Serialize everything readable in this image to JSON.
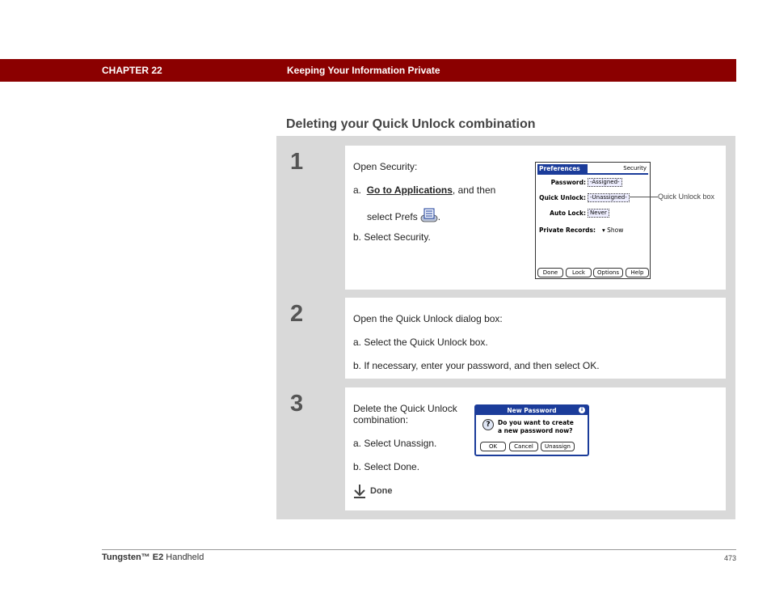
{
  "header": {
    "chapter": "CHAPTER 22",
    "title": "Keeping Your Information Private",
    "bar_color": "#8b0000"
  },
  "section_title": "Deleting your Quick Unlock combination",
  "steps": [
    {
      "number": "1",
      "intro": "Open Security:",
      "a_prefix": "a.",
      "a_link": "Go to Applications",
      "a_rest": ", and then",
      "a_line2": "select Prefs",
      "a_line2_end": ".",
      "b": "b.  Select Security."
    },
    {
      "number": "2",
      "intro": "Open the Quick Unlock dialog box:",
      "a": "a.  Select the Quick Unlock box.",
      "b": "b.  If necessary, enter your password, and then select OK."
    },
    {
      "number": "3",
      "intro_line1": "Delete the Quick Unlock",
      "intro_line2": "combination:",
      "a": "a.  Select Unassign.",
      "b": "b.  Select Done.",
      "done_label": "Done"
    }
  ],
  "palm_security_screen": {
    "tab_active": "Preferences",
    "tab_right": "Security",
    "password_label": "Password:",
    "password_value": "-Assigned-",
    "quick_unlock_label": "Quick Unlock:",
    "quick_unlock_value": "-Unassigned-",
    "auto_lock_label": "Auto Lock:",
    "auto_lock_value": "Never",
    "private_records_label": "Private Records:",
    "private_records_value": "Show",
    "buttons": [
      "Done",
      "Lock",
      "Options",
      "Help"
    ],
    "callout": "Quick Unlock box"
  },
  "palm_dialog": {
    "title": "New Password",
    "message_line1": "Do you want to create",
    "message_line2": "a new password now?",
    "buttons": [
      "OK",
      "Cancel",
      "Unassign"
    ]
  },
  "footer": {
    "product_brand": "Tungsten™ E2",
    "product_rest": " Handheld",
    "page": "473"
  }
}
